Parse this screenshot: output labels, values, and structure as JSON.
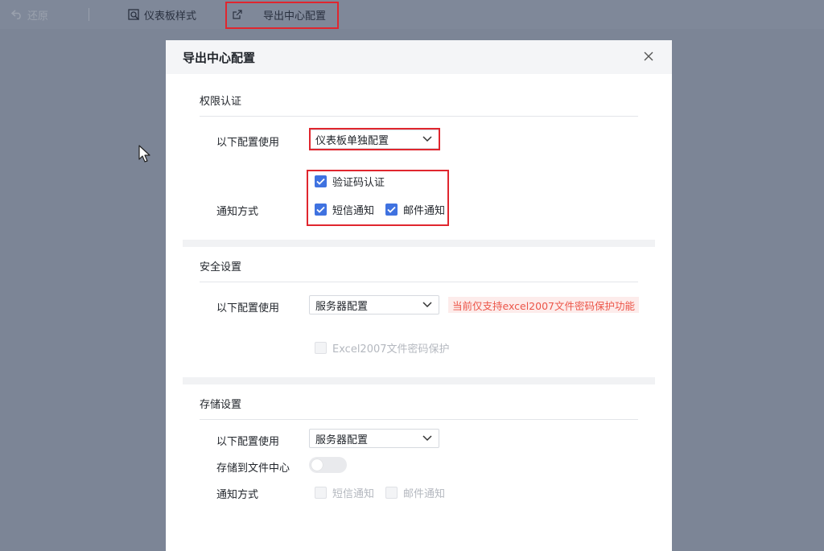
{
  "toolbar": {
    "undo_label": "还原",
    "style_label": "仪表板样式",
    "export_label": "导出中心配置"
  },
  "dialog": {
    "title": "导出中心配置",
    "auth": {
      "section_title": "权限认证",
      "config_label": "以下配置使用",
      "config_value": "仪表板单独配置",
      "captcha_label": "验证码认证",
      "captcha_checked": true,
      "notify_label": "通知方式",
      "sms_label": "短信通知",
      "sms_checked": true,
      "email_label": "邮件通知",
      "email_checked": true
    },
    "security": {
      "section_title": "安全设置",
      "config_label": "以下配置使用",
      "config_value": "服务器配置",
      "warning": "当前仅支持excel2007文件密码保护功能",
      "excel_protect_label": "Excel2007文件密码保护",
      "excel_protect_checked": false
    },
    "storage": {
      "section_title": "存储设置",
      "config_label": "以下配置使用",
      "config_value": "服务器配置",
      "store_label": "存储到文件中心",
      "store_enabled": false,
      "notify_label": "通知方式",
      "sms_label": "短信通知",
      "sms_checked": false,
      "email_label": "邮件通知",
      "email_checked": false
    }
  },
  "colors": {
    "accent": "#3f72e0",
    "highlight": "#e0262e",
    "warning_text": "#ec5548",
    "warning_bg": "#fdeceb"
  }
}
